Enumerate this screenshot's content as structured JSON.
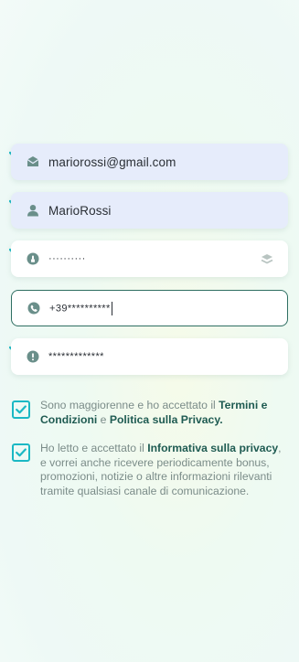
{
  "form": {
    "email": {
      "value": "mariorossi@gmail.com",
      "icon": "email-icon",
      "valid": true
    },
    "username": {
      "value": "MarioRossi",
      "icon": "user-icon",
      "valid": true
    },
    "password": {
      "value": "··········",
      "icon": "lock-icon",
      "toggle_icon": "eye-icon",
      "valid": true
    },
    "phone": {
      "value": "+39**********",
      "icon": "phone-icon",
      "focused": true
    },
    "code": {
      "value": "*************",
      "icon": "alert-icon",
      "valid": true
    }
  },
  "consents": {
    "terms": {
      "checked": true,
      "text_1": "Sono maggiorenne e ho accettato il ",
      "link_1": "Termini e Condizioni",
      "text_2": " e ",
      "link_2": "Politica sulla Privacy."
    },
    "privacy": {
      "checked": true,
      "text_1": "Ho letto e accettato il ",
      "link_1": "Informativa sulla privacy",
      "text_2": ", e vorrei anche ricevere periodicamente bonus, promozioni, notizie o altre informazioni rilevanti tramite qualsiasi canale di comunicazione."
    }
  },
  "colors": {
    "accent": "#1bb8c4",
    "icon": "#6a8f8a",
    "link": "#1f5b52",
    "field_filled": "#e6ecfb",
    "focus_border": "#2f6f62"
  }
}
